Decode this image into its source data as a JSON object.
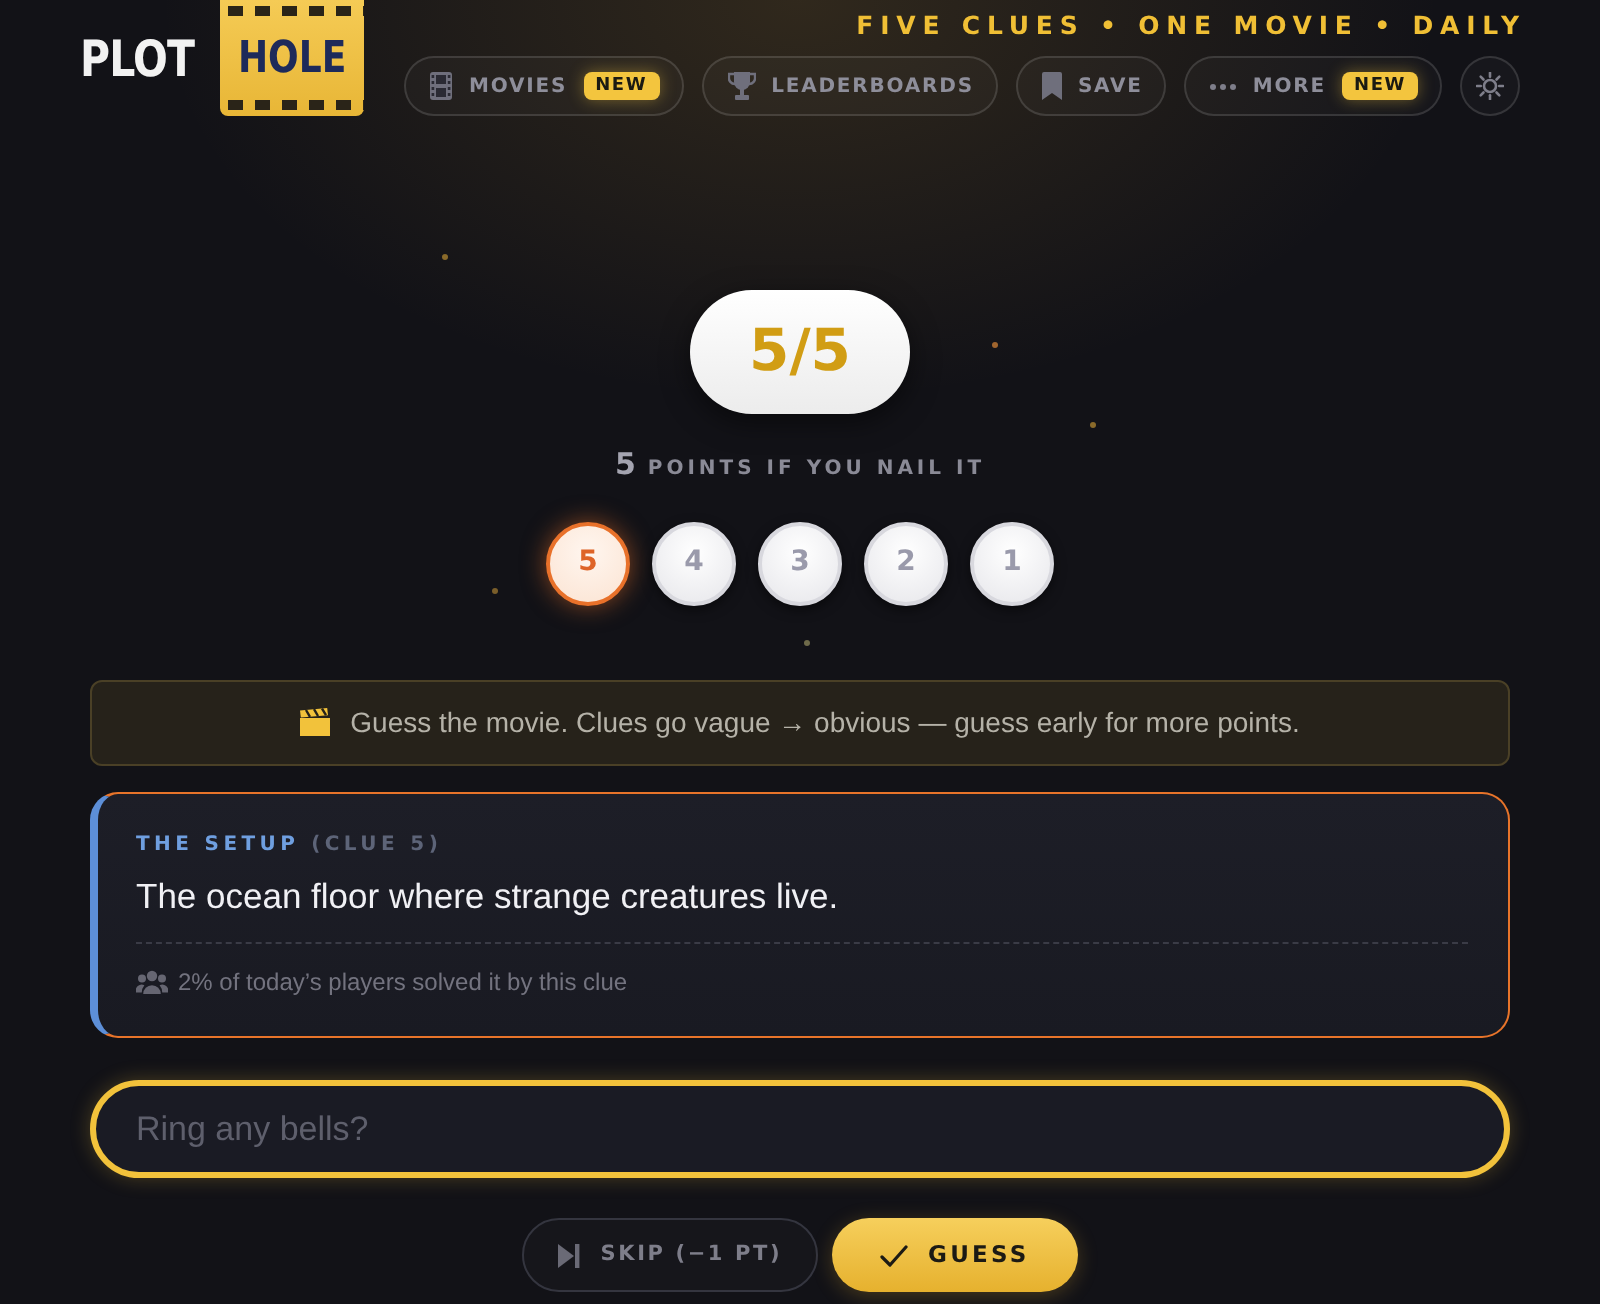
{
  "header": {
    "logo": {
      "plain_word": "PLOT",
      "tile_word": "HOLE"
    },
    "tagline": "FIVE CLUES • ONE MOVIE • DAILY",
    "nav": [
      {
        "label": "MOVIES",
        "badge": "NEW"
      },
      {
        "label": "LEADERBOARDS"
      },
      {
        "label": "SAVE"
      },
      {
        "label": "MORE",
        "badge": "NEW"
      }
    ]
  },
  "score": "5/5",
  "points": {
    "value": "5",
    "label": "POINTS IF YOU NAIL IT"
  },
  "clue_steps": [
    {
      "label": "5",
      "selected": true
    },
    {
      "label": "4",
      "selected": false
    },
    {
      "label": "3",
      "selected": false
    },
    {
      "label": "2",
      "selected": false
    },
    {
      "label": "1",
      "selected": false
    }
  ],
  "hint_banner": {
    "text": "Guess the movie. Clues go vague → obvious — guess early for more points."
  },
  "clue_card": {
    "title": "THE SETUP",
    "clue_number": "(CLUE 5)",
    "text": "The ocean floor where strange creatures live.",
    "stat": "2% of today’s players solved it by this clue"
  },
  "guess_field": {
    "placeholder": "Ring any bells?"
  },
  "actions": [
    {
      "kind": "skip",
      "label": "SKIP (−1 PT)"
    },
    {
      "kind": "guess",
      "label": "GUESS"
    }
  ]
}
